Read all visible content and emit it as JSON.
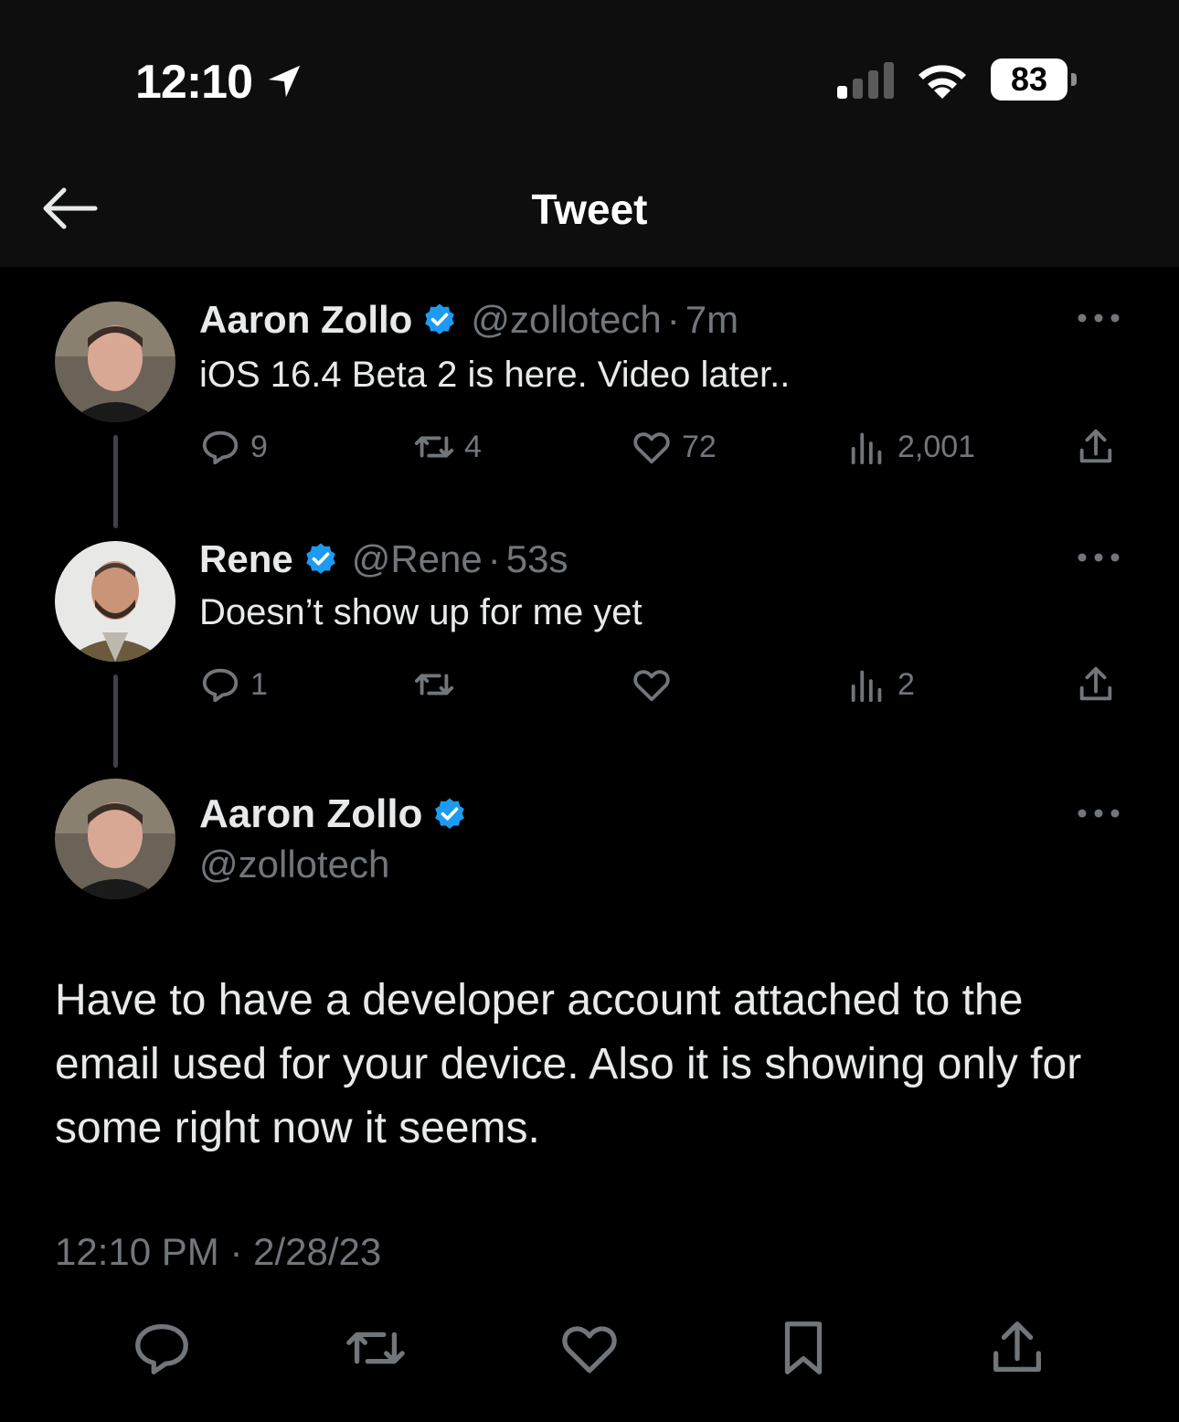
{
  "status_bar": {
    "time": "12:10",
    "battery": "83"
  },
  "nav": {
    "title": "Tweet"
  },
  "thread": [
    {
      "name": "Aaron Zollo",
      "handle": "@zollotech",
      "separator": "·",
      "age": "7m",
      "text": "iOS 16.4 Beta 2 is here.  Video later..",
      "replies": "9",
      "retweets": "4",
      "likes": "72",
      "views": "2,001"
    },
    {
      "name": "Rene",
      "handle": "@Rene",
      "separator": "·",
      "age": "53s",
      "text": "Doesn’t show up for me yet",
      "replies": "1",
      "retweets": "",
      "likes": "",
      "views": "2"
    }
  ],
  "main_tweet": {
    "name": "Aaron Zollo",
    "handle": "@zollotech",
    "text": "Have to have a developer account attached to the email used for your device.  Also it is showing only for some right now it seems.",
    "timestamp": "12:10 PM · 2/28/23"
  },
  "colors": {
    "verified": "#1d9bf0",
    "muted": "#71767b",
    "text": "#e7e9ea",
    "background": "#000000"
  },
  "icons": [
    "location-arrow-icon",
    "signal-icon",
    "wifi-icon",
    "battery-icon",
    "back-arrow-icon",
    "verified-icon",
    "more-icon",
    "reply-icon",
    "retweet-icon",
    "like-icon",
    "views-icon",
    "share-icon",
    "bookmark-icon"
  ]
}
